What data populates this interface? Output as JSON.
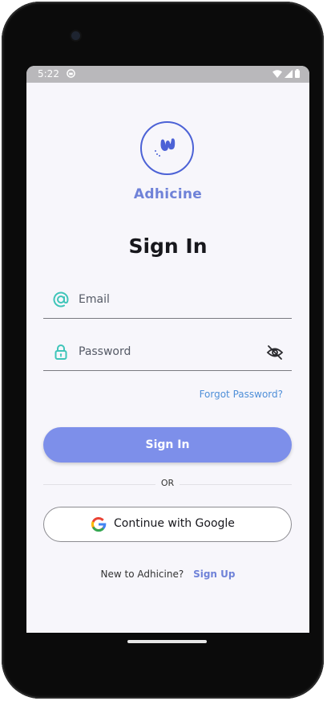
{
  "status_bar": {
    "time": "5:22"
  },
  "app": {
    "brand_name": "Adhicine",
    "accent_color": "#7d8fea",
    "link_color": "#4f8fd8"
  },
  "sign_in": {
    "title": "Sign In",
    "email_placeholder": "Email",
    "password_placeholder": "Password",
    "forgot_password": "Forgot Password?",
    "sign_in_button": "Sign In",
    "divider_text": "OR",
    "google_button": "Continue with Google",
    "new_user_prompt": "New to Adhicine?",
    "sign_up_link": "Sign Up"
  },
  "icons": {
    "email": "at-sign-icon",
    "password": "padlock-icon",
    "visibility": "eye-off-icon",
    "google": "google-logo-icon"
  }
}
